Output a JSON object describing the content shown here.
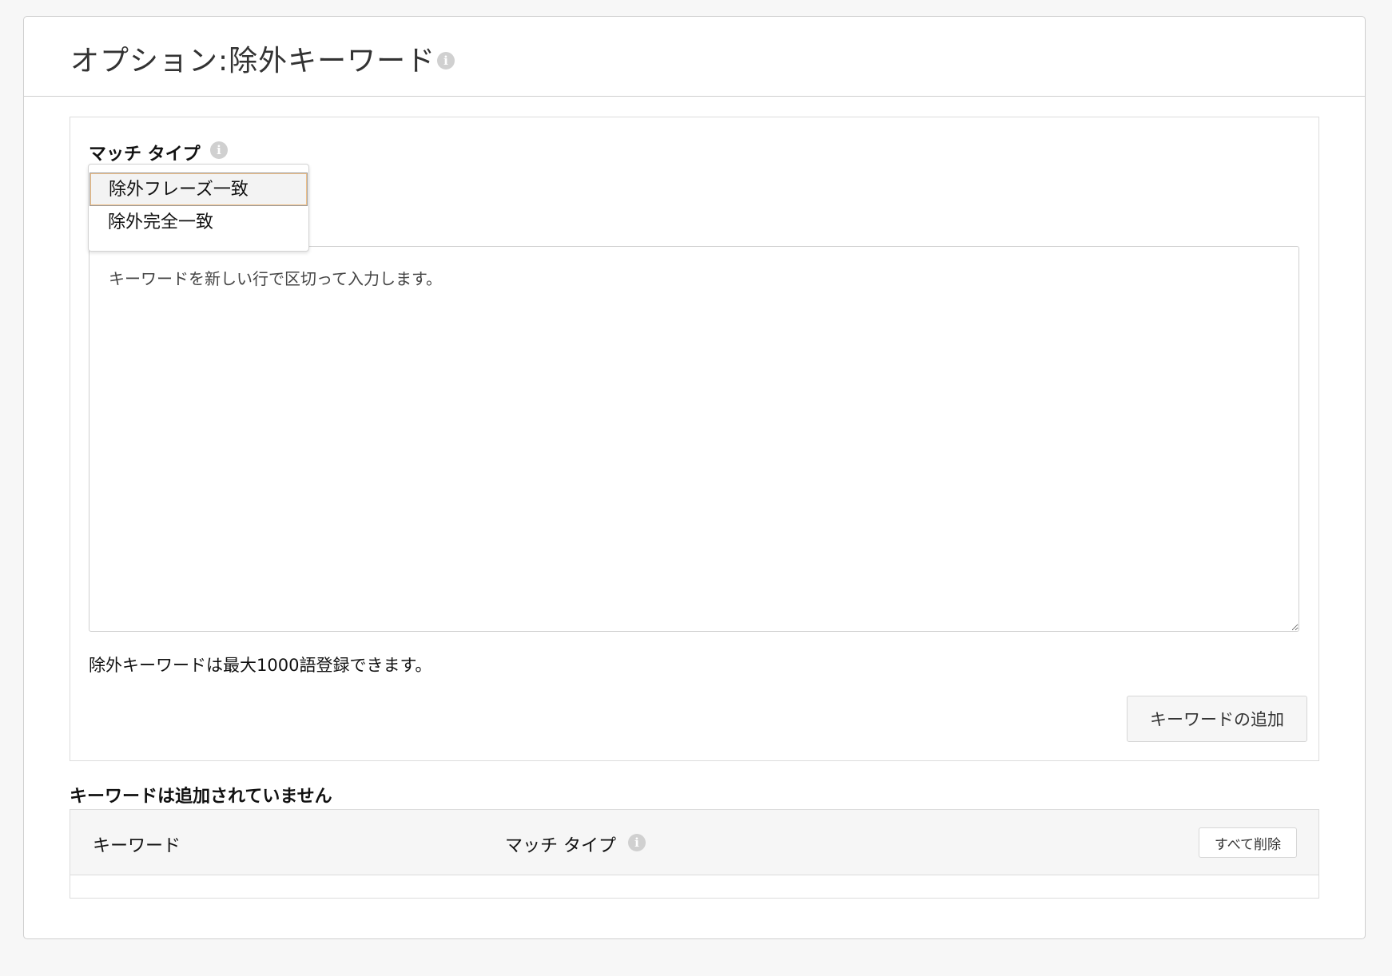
{
  "header": {
    "title": "オプション:除外キーワード"
  },
  "form": {
    "match_type_label": "マッチ タイプ",
    "match_type_options": [
      "除外フレーズ一致",
      "除外完全一致"
    ],
    "keywords_placeholder": "キーワードを新しい行で区切って入力します。",
    "limit_note": "除外キーワードは最大1000語登録できます。",
    "add_button_label": "キーワードの追加"
  },
  "keyword_list": {
    "empty_label": "キーワードは追加されていません",
    "columns": {
      "keyword": "キーワード",
      "match_type": "マッチ タイプ"
    },
    "delete_all_label": "すべて削除"
  },
  "icons": {
    "info": "info-icon"
  },
  "colors": {
    "selected_option_border": "#f0c089",
    "border": "#cfcfcf",
    "header_bg": "#f6f6f6"
  }
}
